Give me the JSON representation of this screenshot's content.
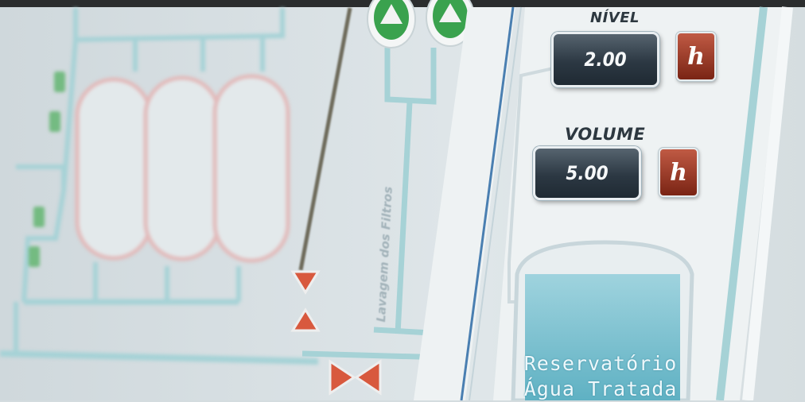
{
  "panel": {
    "nivel_label": "NÍVEL",
    "nivel_value": "2.00",
    "volume_label": "VOLUME",
    "volume_value": "5.00",
    "h_button_label": "h"
  },
  "process": {
    "filter_wash_label": "Lavagem dos Filtros",
    "reservoir_line1": "Reservatório",
    "reservoir_line2": "Água Tratada"
  },
  "colors": {
    "pipe": "#a6d2d6",
    "pump_green": "#3aa24e",
    "valve_red": "#d0533a",
    "display_bg": "#2c3843",
    "h_button": "#9a3a27",
    "tank_water": "#7ec3d2"
  },
  "icons": [
    "pump-icon",
    "valve-icon",
    "filter-tank-icon",
    "reservoir-icon"
  ]
}
